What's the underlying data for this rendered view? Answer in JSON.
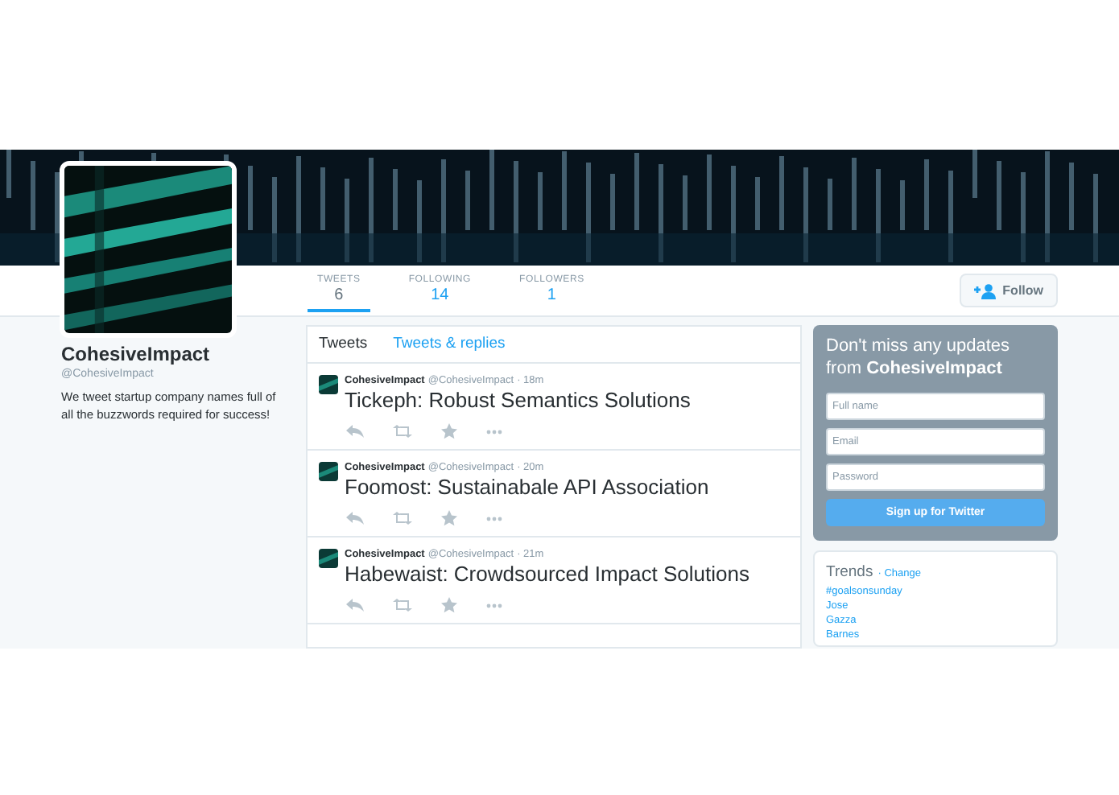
{
  "profile": {
    "name": "CohesiveImpact",
    "handle": "@CohesiveImpact",
    "bio": "We tweet startup company names full of all the buzzwords required for success!"
  },
  "stats": [
    {
      "label": "TWEETS",
      "value": "6",
      "selected": true
    },
    {
      "label": "FOLLOWING",
      "value": "14",
      "selected": false
    },
    {
      "label": "FOLLOWERS",
      "value": "1",
      "selected": false
    }
  ],
  "follow_button": "Follow",
  "tabs": [
    {
      "label": "Tweets",
      "selected": true
    },
    {
      "label": "Tweets & replies",
      "selected": false
    }
  ],
  "tweets": [
    {
      "name": "CohesiveImpact",
      "handle": "@CohesiveImpact",
      "time": "· 18m",
      "text": "Tickeph: Robust Semantics Solutions"
    },
    {
      "name": "CohesiveImpact",
      "handle": "@CohesiveImpact",
      "time": "· 20m",
      "text": "Foomost: Sustainabale API Association"
    },
    {
      "name": "CohesiveImpact",
      "handle": "@CohesiveImpact",
      "time": "· 21m",
      "text": "Habewaist: Crowdsourced Impact Solutions"
    }
  ],
  "signup": {
    "heading": "Don't miss any updates from **CohesiveImpact**",
    "fields": [
      {
        "placeholder": "Full name"
      },
      {
        "placeholder": "Email"
      },
      {
        "placeholder": "Password"
      }
    ],
    "button": "Sign up for Twitter"
  },
  "trends": {
    "title": "Trends",
    "change": "· Change",
    "items": [
      "#goalsonsunday",
      "Jose",
      "Gazza",
      "Barnes"
    ]
  }
}
